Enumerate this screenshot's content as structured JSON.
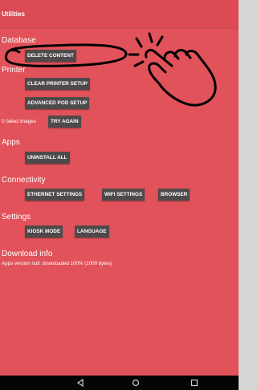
{
  "appbar": {
    "title": "Utilities"
  },
  "database": {
    "title": "Database",
    "delete_label": "DELETE CONTENT"
  },
  "printer": {
    "title": "Printer",
    "clear_label": "CLEAR PRINTER SETUP",
    "advanced_label": "ADVANCED POD SETUP",
    "failed_text": "0 failed images",
    "try_again_label": "TRY AGAIN"
  },
  "apps": {
    "title": "Apps",
    "uninstall_label": "UNINSTALL ALL"
  },
  "connectivity": {
    "title": "Connectivity",
    "ethernet_label": "ETHERNET SETTINGS",
    "wifi_label": "WIFI SETTINGS",
    "browser_label": "BROWSER"
  },
  "settings": {
    "title": "Settings",
    "kiosk_label": "KIOSK MODE",
    "language_label": "LANGUAGE"
  },
  "download": {
    "title": "Download info",
    "text": "Apps version null: downloaded 100% (1000 bytes)"
  },
  "colors": {
    "background": "#e1525a",
    "button": "#4e4a4b",
    "navbar": "#050505"
  },
  "navbar": {
    "icons": [
      "back-icon",
      "home-icon",
      "recents-icon"
    ]
  }
}
